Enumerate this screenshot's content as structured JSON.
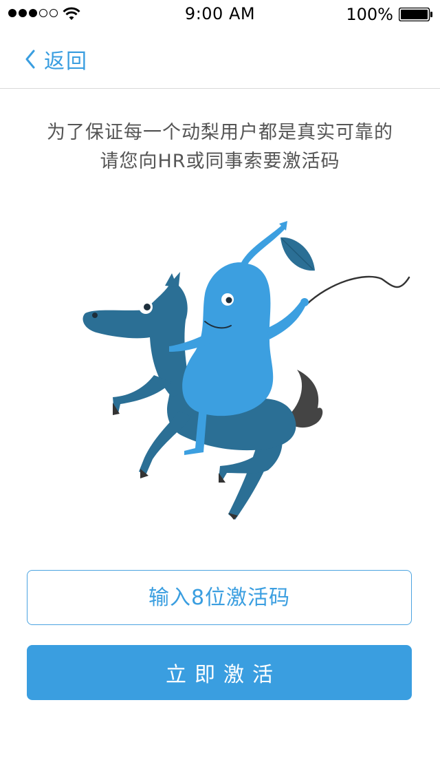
{
  "status_bar": {
    "time": "9:00 AM",
    "battery": "100%",
    "signal_bars_filled": 3,
    "signal_bars_total": 5
  },
  "nav": {
    "back_label": "返回",
    "back_icon": "chevron-left-icon"
  },
  "intro": {
    "line1": "为了保证每一个动梨用户都是真实可靠的",
    "line2": "请您向HR或同事索要激活码"
  },
  "illustration": {
    "subject": "pear-riding-horse"
  },
  "form": {
    "code_placeholder": "输入8位激活码",
    "activate_label": "立即激活"
  },
  "colors": {
    "accent": "#3a9ee0",
    "horse": "#2b6f95",
    "pear": "#3c9fe0",
    "text": "#555555"
  }
}
